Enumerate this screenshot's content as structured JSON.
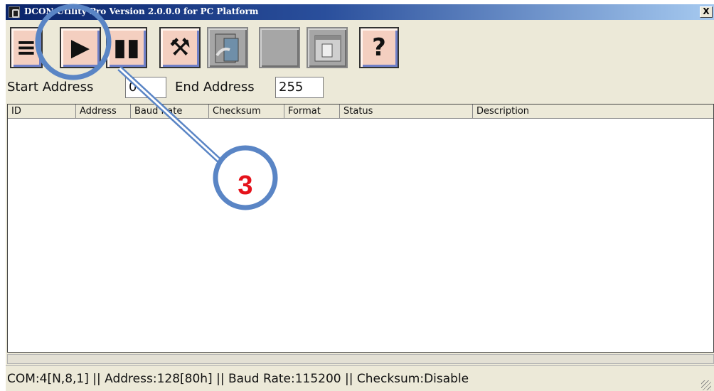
{
  "window": {
    "title": "DCON Utility Pro Version 2.0.0.0 for PC Platform",
    "close_symbol": "X"
  },
  "toolbar": {
    "buttons": [
      {
        "name": "filter-icon",
        "glyph": "≡"
      },
      {
        "name": "play-icon",
        "glyph": "▶"
      },
      {
        "name": "pause-icon",
        "glyph": "▮▮"
      },
      {
        "name": "tools-icon",
        "glyph": "⚒"
      },
      {
        "name": "module-icon",
        "glyph": ""
      },
      {
        "name": "blank-icon",
        "glyph": ""
      },
      {
        "name": "window-icon",
        "glyph": ""
      },
      {
        "name": "help-icon",
        "glyph": "?"
      }
    ]
  },
  "address": {
    "start_label": "Start Address",
    "start_value": "0",
    "end_label": "End Address",
    "end_value": "255"
  },
  "list": {
    "columns": [
      "ID",
      "Address",
      "Baud Rate",
      "Checksum",
      "Format",
      "Status",
      "Description"
    ],
    "rows": []
  },
  "status": {
    "text": "COM:4[N,8,1] || Address:128[80h] || Baud Rate:115200 || Checksum:Disable"
  },
  "annotation": {
    "label": "3"
  },
  "colors": {
    "button_face": "#f4cfc0",
    "annotation_stroke": "#5a85c5",
    "annotation_text": "#e5121b"
  }
}
